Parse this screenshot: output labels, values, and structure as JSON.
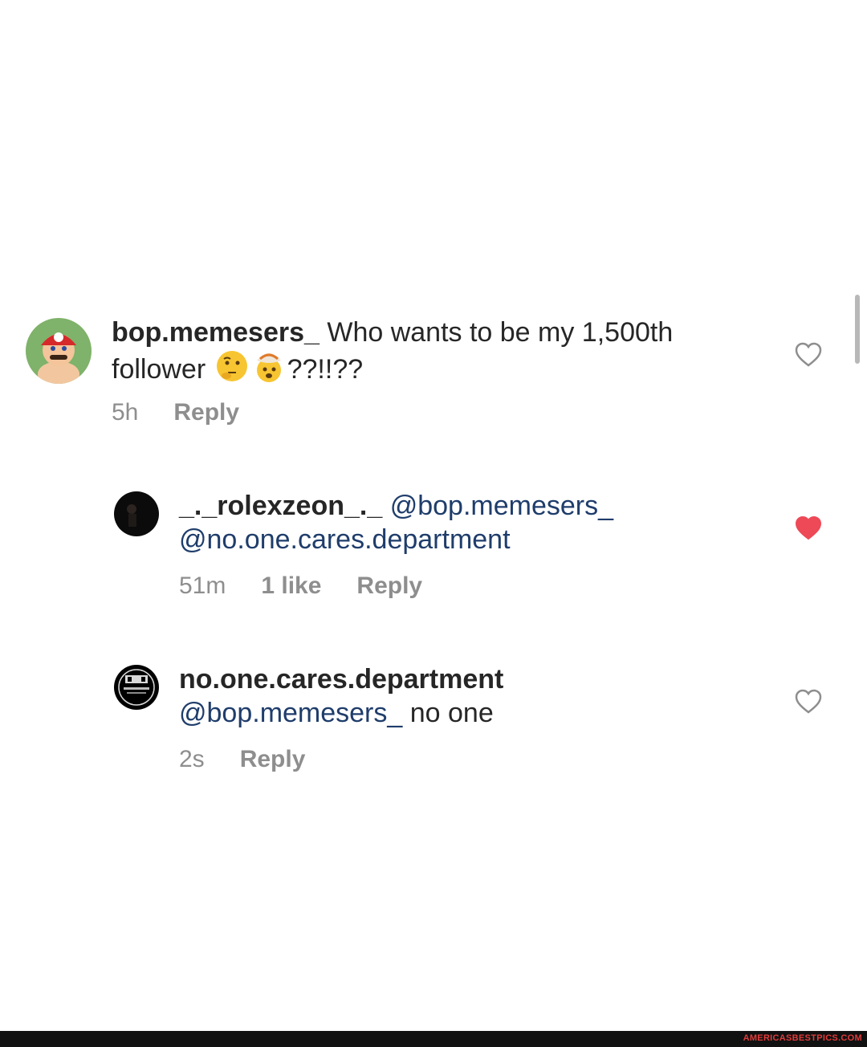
{
  "comments": [
    {
      "username": "bop.memesers_",
      "text_part1": " Who wants to be my 1,500th",
      "text_part2": "follower ",
      "text_part3": "??!!??",
      "emojis": [
        "thinking-face",
        "exploding-head"
      ],
      "time": "5h",
      "reply_label": "Reply",
      "liked": false
    },
    {
      "username": "_._rolexzeon_._",
      "mention1": "@bop.memesers_",
      "mention2": "@no.one.cares.department",
      "time": "51m",
      "likes": "1 like",
      "reply_label": "Reply",
      "liked": true
    },
    {
      "username": "no.one.cares.department",
      "mention": "@bop.memesers_",
      "text": " no one",
      "time": "2s",
      "reply_label": "Reply",
      "liked": false
    }
  ],
  "footer": {
    "watermark": "AMERICASBESTPICS.COM"
  },
  "colors": {
    "like_red": "#ed4956",
    "mention_blue": "#1f3d6b",
    "meta_gray": "#8e8e8e"
  }
}
